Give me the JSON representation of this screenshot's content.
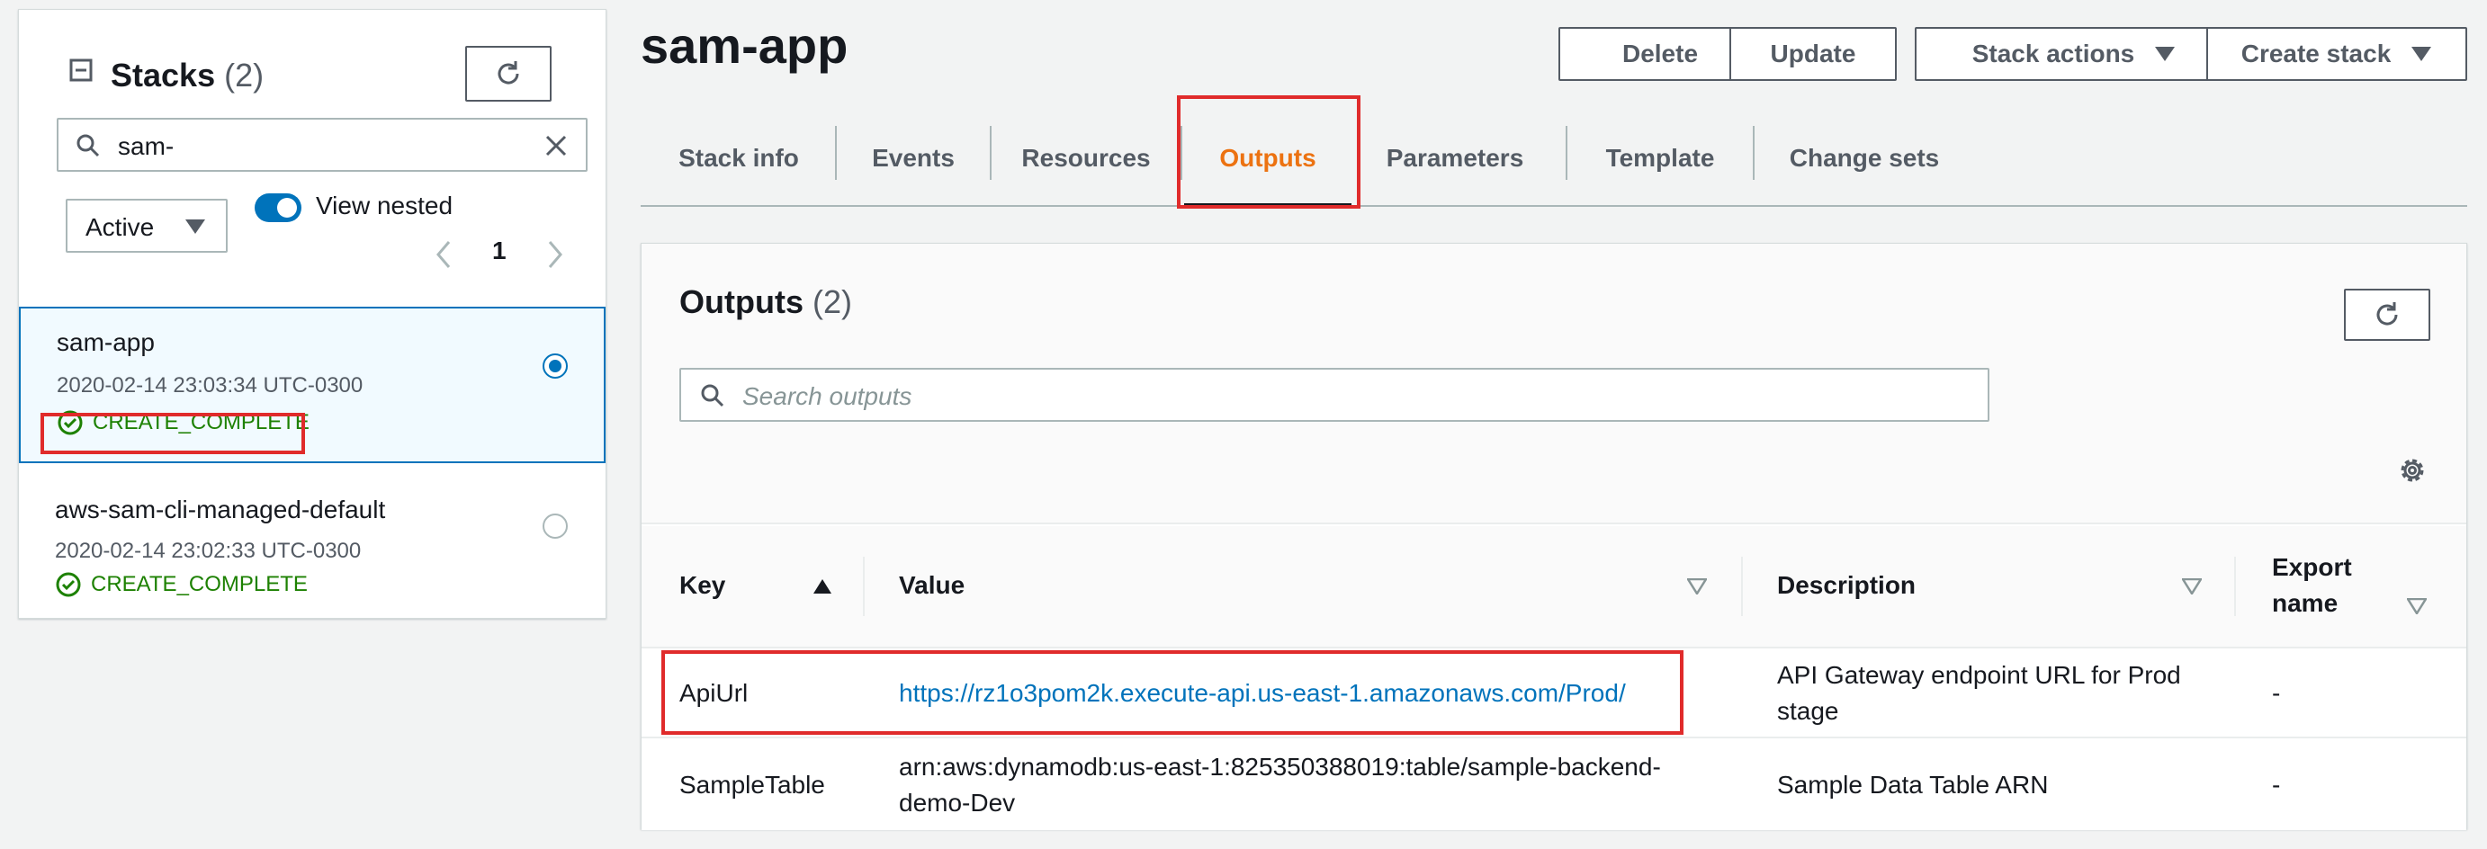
{
  "left_panel": {
    "title": "Stacks",
    "count": "(2)",
    "search": {
      "value": "sam-"
    },
    "filter": {
      "selected": "Active"
    },
    "toggle": {
      "label": "View nested",
      "on": true
    },
    "pagination": {
      "current_page": "1"
    },
    "stacks": [
      {
        "name": "sam-app",
        "timestamp": "2020-02-14 23:03:34 UTC-0300",
        "status": "CREATE_COMPLETE",
        "selected": true
      },
      {
        "name": "aws-sam-cli-managed-default",
        "timestamp": "2020-02-14 23:02:33 UTC-0300",
        "status": "CREATE_COMPLETE",
        "selected": false
      }
    ]
  },
  "header": {
    "title": "sam-app",
    "actions": {
      "delete": "Delete",
      "update": "Update",
      "stack_actions": "Stack actions",
      "create_stack": "Create stack"
    }
  },
  "tabs": [
    "Stack info",
    "Events",
    "Resources",
    "Outputs",
    "Parameters",
    "Template",
    "Change sets"
  ],
  "active_tab": "Outputs",
  "outputs": {
    "title": "Outputs",
    "count": "(2)",
    "search_placeholder": "Search outputs",
    "columns": {
      "key": "Key",
      "value": "Value",
      "description": "Description",
      "export_line1": "Export",
      "export_line2": "name"
    },
    "rows": [
      {
        "key": "ApiUrl",
        "value": "https://rz1o3pom2k.execute-api.us-east-1.amazonaws.com/Prod/",
        "description_line1": "API Gateway endpoint URL for Prod",
        "description_line2": "stage",
        "export_name": "-"
      },
      {
        "key": "SampleTable",
        "value_line1": "arn:aws:dynamodb:us-east-1:825350388019:table/sample-backend-",
        "value_line2": "demo-Dev",
        "description": "Sample Data Table ARN",
        "export_name": "-"
      }
    ]
  },
  "colors": {
    "accent_blue": "#0073bb",
    "active_tab_orange": "#ec7211",
    "success_green": "#1d8102",
    "highlight_red": "#e02b2b",
    "text_dark": "#16191f",
    "text_gray": "#545b64"
  },
  "icons": [
    "collapse-icon",
    "refresh-icon",
    "search-icon",
    "close-icon",
    "caret-down-icon",
    "chevron-left-icon",
    "chevron-right-icon",
    "check-circle-icon",
    "settings-icon",
    "sort-ascending-icon",
    "sort-icon"
  ]
}
